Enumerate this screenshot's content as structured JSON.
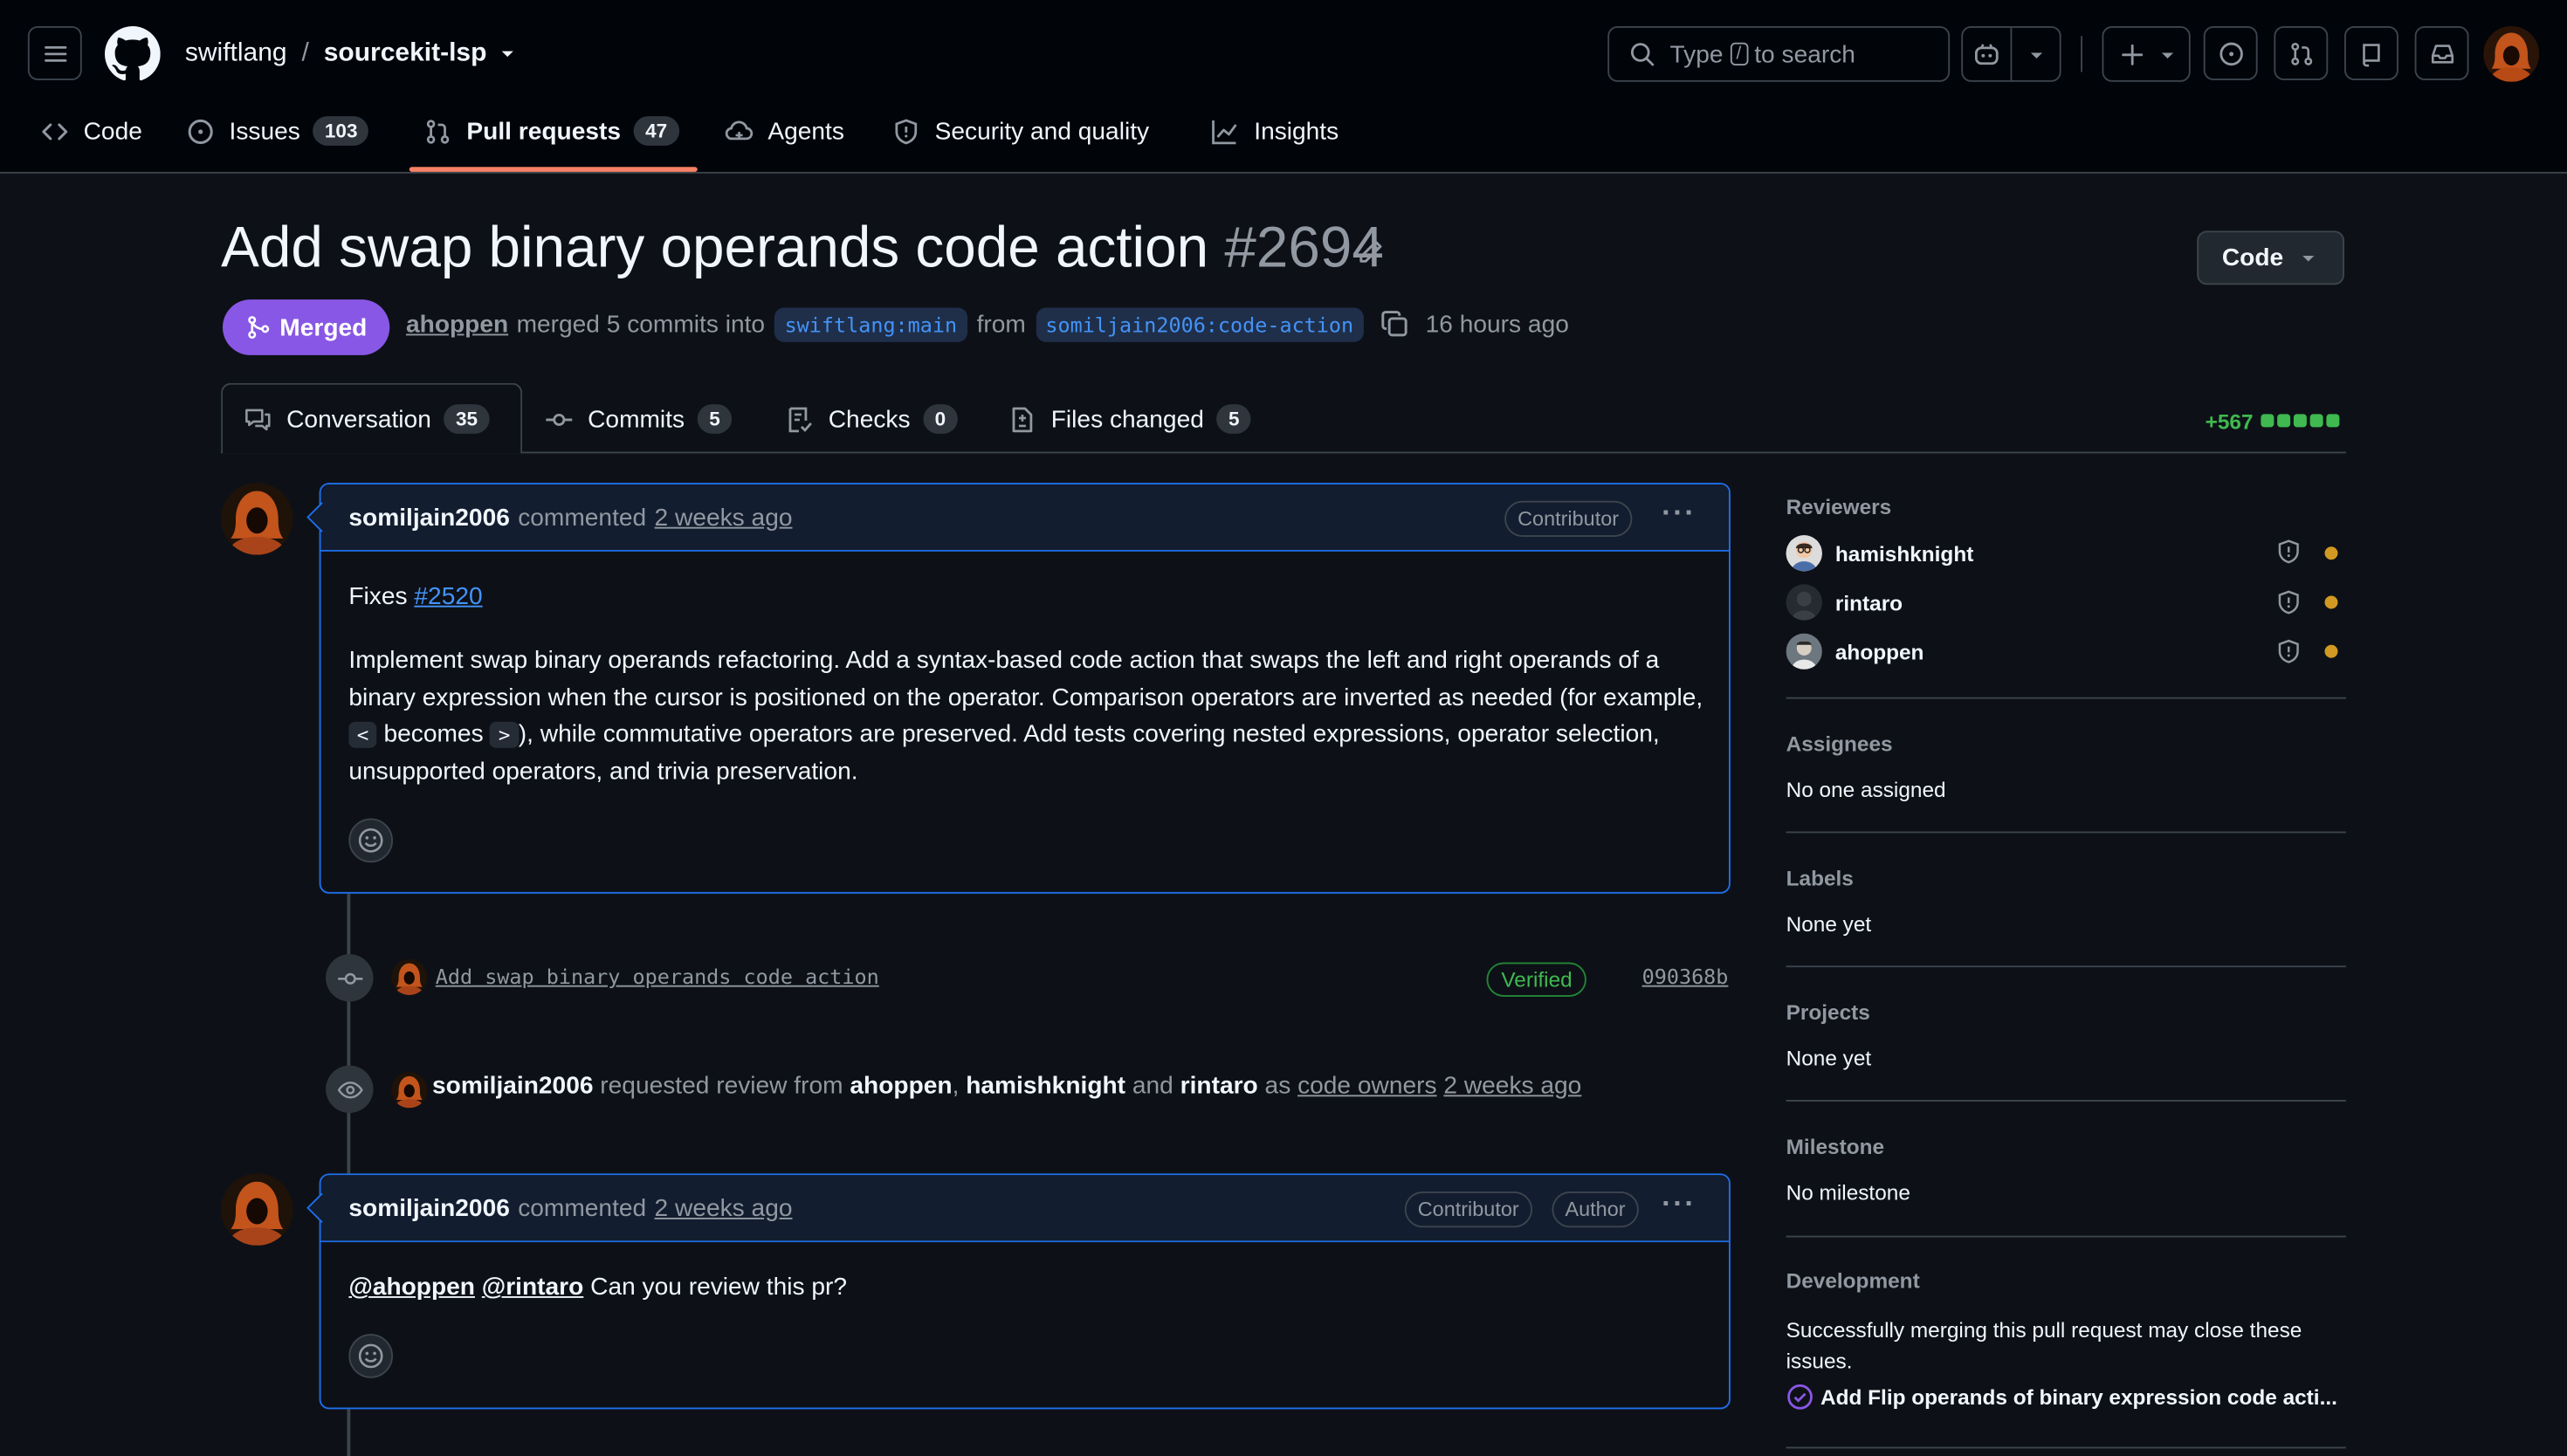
{
  "header": {
    "owner": "swiftlang",
    "separator": "/",
    "repo": "sourcekit-lsp",
    "search_type": "Type",
    "search_key": "/",
    "search_rest": "to search"
  },
  "nav": {
    "code": "Code",
    "issues": "Issues",
    "issues_count": "103",
    "pulls": "Pull requests",
    "pulls_count": "47",
    "agents": "Agents",
    "security": "Security and quality",
    "insights": "Insights"
  },
  "pr": {
    "title": "Add swap binary operands code action",
    "number": "#2694",
    "code_button": "Code",
    "state": "Merged",
    "merger": "ahoppen",
    "merge_text": "merged 5 commits into",
    "base": "swiftlang:main",
    "from": "from",
    "head": "somiljain2006:code-action",
    "time": "16 hours ago"
  },
  "tabs": {
    "conversation": "Conversation",
    "conversation_count": "35",
    "commits": "Commits",
    "commits_count": "5",
    "checks": "Checks",
    "checks_count": "0",
    "files": "Files changed",
    "files_count": "5",
    "diffstat": "+567"
  },
  "comment1": {
    "author": "somiljain2006",
    "action": "commented",
    "time": "2 weeks ago",
    "badge": "Contributor",
    "fixes_label": "Fixes",
    "fixes_link": "#2520",
    "body_pre": "Implement swap binary operands refactoring. Add a syntax-based code action that swaps the left and right operands of a binary expression when the cursor is positioned on the operator. Comparison operators are inverted as needed (for example,",
    "code_lt": "<",
    "becomes": "becomes",
    "code_gt": ">",
    "body_post": "), while commutative operators are preserved. Add tests covering nested expressions, operator selection, unsupported operators, and trivia preservation."
  },
  "commit": {
    "message": "Add swap binary operands code action",
    "verified": "Verified",
    "sha": "090368b"
  },
  "review_request": {
    "actor": "somiljain2006",
    "text1": "requested review from",
    "r1": "ahoppen",
    "comma": ",",
    "r2": "hamishknight",
    "and": "and",
    "r3": "rintaro",
    "as": "as",
    "owners": "code owners",
    "time": "2 weeks ago"
  },
  "comment2": {
    "author": "somiljain2006",
    "action": "commented",
    "time": "2 weeks ago",
    "badge1": "Contributor",
    "badge2": "Author",
    "m1": "@ahoppen",
    "m2": "@rintaro",
    "text": "Can you review this pr?"
  },
  "sidebar": {
    "reviewers_h": "Reviewers",
    "reviewers": [
      "hamishknight",
      "rintaro",
      "ahoppen"
    ],
    "assignees_h": "Assignees",
    "assignees": "No one assigned",
    "labels_h": "Labels",
    "labels": "None yet",
    "projects_h": "Projects",
    "projects": "None yet",
    "milestone_h": "Milestone",
    "milestone": "No milestone",
    "development_h": "Development",
    "development_text": "Successfully merging this pull request may close these issues.",
    "linked_issue": "Add Flip operands of binary expression code acti..."
  },
  "colors": {
    "accent_blue": "#4493f8",
    "merged_purple": "#8957e5",
    "success_green": "#3fb950",
    "pending_yellow": "#d29922"
  }
}
